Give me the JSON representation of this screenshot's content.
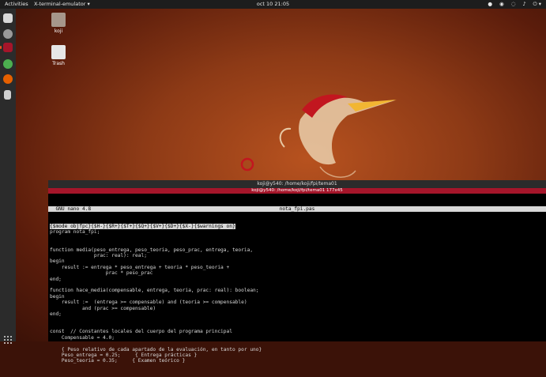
{
  "topbar": {
    "activities": "Activities",
    "app_menu": "X-terminal-emulator ▾",
    "clock": "oct 10  21:05",
    "tray": [
      "●",
      "◉",
      "◌",
      "♪",
      "⏻ ▾"
    ]
  },
  "dock": {
    "items": [
      {
        "name": "files-icon",
        "color": "#d8d8d8"
      },
      {
        "name": "music-icon",
        "color": "#9a9a9a"
      },
      {
        "name": "terminal-icon",
        "color": "#a5152a",
        "active": true
      },
      {
        "name": "chrome-icon",
        "color": "#4caf50"
      },
      {
        "name": "firefox-icon",
        "color": "#e66000"
      },
      {
        "name": "document-icon",
        "color": "#cfcfcf"
      }
    ]
  },
  "desktop": {
    "icons": [
      {
        "label": "koji",
        "color": "#a6978b"
      },
      {
        "label": "Trash",
        "color": "#e6e6e6"
      }
    ]
  },
  "terminal": {
    "title": "koji@y540: /home/koji/fpi/tema01",
    "subtitle": "koji@y540: /home/koji/fpi/tema01 177x45",
    "nano_version": "  GNU nano 4.8",
    "nano_file": "nota_fpi.pas",
    "lines": [
      "{$mode objfpc}{$H-}{$R+}{$T+}{$Q+}{$V+}{$D+}{$X-}{$warnings on}",
      "program nota_fpi;",
      "",
      "",
      "function media(peso_entrega, peso_teoria, peso_prac, entrega, teoria,",
      "               prac: real): real;",
      "begin",
      "    result := entrega * peso_entrega + teoria * peso_teoria +",
      "                   prac * peso_prac",
      "end;",
      "",
      "function hace_media(compensable, entrega, teoria, prac: real): boolean;",
      "begin",
      "    result :=  (entrega >= compensable) and (teoria >= compensable)",
      "           and (prac >= compensable)",
      "end;",
      "",
      "",
      "const  // Constantes locales del cuerpo del programa principal",
      "    Compensable = 4.0;",
      "",
      "    { Peso relativo de cada apartado de la evaluación, en tanto por uno}",
      "    Peso_entrega = 0.25;     { Entrega prácticas }",
      "    Peso_teoria = 0.35;     { Examen teórico }"
    ]
  },
  "colors": {
    "accent": "#e95420",
    "terminal_header": "#a5152a"
  }
}
